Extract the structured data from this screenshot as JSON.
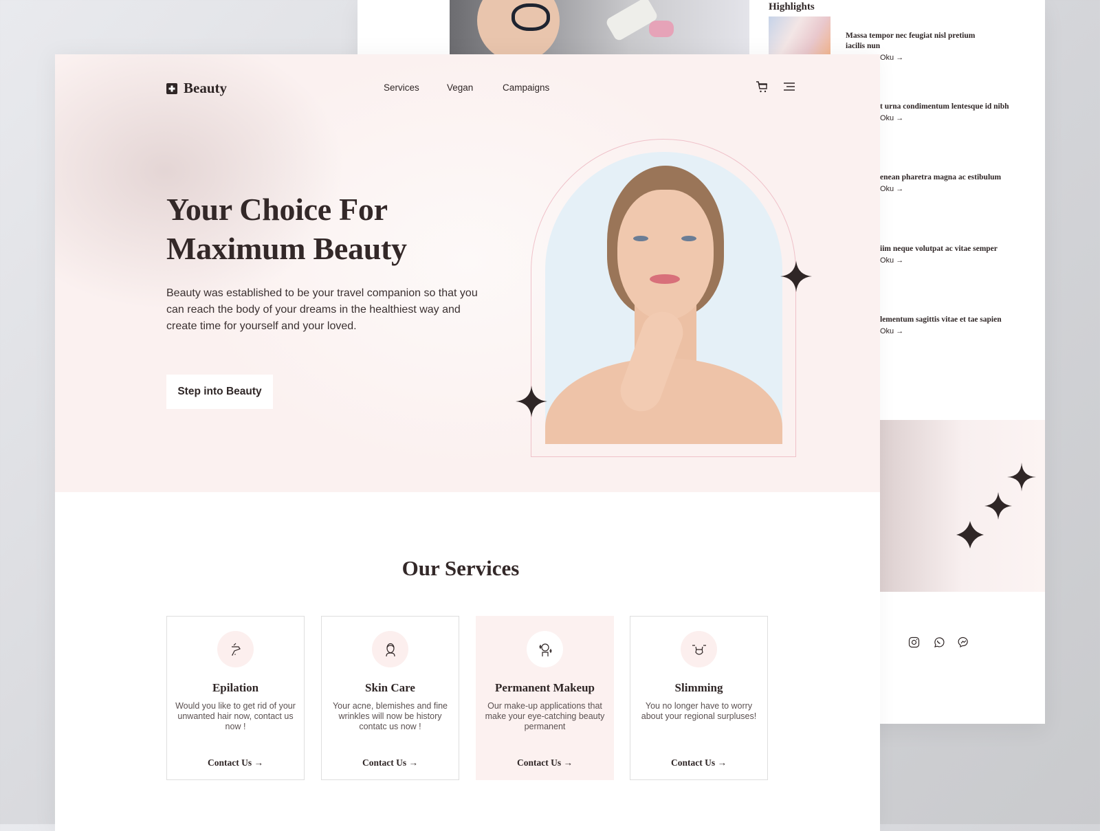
{
  "back_page": {
    "highlights_title": "Highlights",
    "highlights": [
      {
        "title": "Massa tempor nec feugiat nisl pretium iacilis nun",
        "link": "Oku"
      },
      {
        "title": "t urna condimentum lentesque id nibh",
        "link": "Oku"
      },
      {
        "title": "enean pharetra magna ac estibulum",
        "link": "Oku"
      },
      {
        "title": "iim neque volutpat ac vitae semper",
        "link": "Oku"
      },
      {
        "title": "lementum sagittis vitae et tae sapien",
        "link": "Oku"
      }
    ],
    "socials": [
      "instagram-icon",
      "whatsapp-icon",
      "messenger-icon"
    ]
  },
  "header": {
    "brand": "Beauty",
    "nav": [
      "Services",
      "Vegan",
      "Campaigns"
    ],
    "icons": [
      "cart-icon",
      "menu-icon"
    ]
  },
  "hero": {
    "title_line1": "Your Choice For",
    "title_line2": "Maximum Beauty",
    "description": "Beauty was established to be your travel companion so that you can reach the body of your dreams in the healthiest way and create time for yourself and your loved.",
    "cta": "Step into Beauty"
  },
  "services": {
    "title": "Our Services",
    "cards": [
      {
        "title": "Epilation",
        "desc": "Would you like to get rid of your unwanted hair now, contact us now !",
        "link": "Contact Us",
        "icon": "epilation-device-icon"
      },
      {
        "title": "Skin Care",
        "desc": "Your acne, blemishes and fine wrinkles will now be history contatc us now !",
        "link": "Contact Us",
        "icon": "woman-face-icon"
      },
      {
        "title": "Permanent Makeup",
        "desc": "Our make-up applications that make your eye-catching beauty permanent",
        "link": "Contact Us",
        "icon": "makeup-face-icon"
      },
      {
        "title": "Slimming",
        "desc": "You no longer have to worry about your regional surpluses!",
        "link": "Contact Us",
        "icon": "waist-icon"
      }
    ]
  },
  "colors": {
    "text": "#2f2626",
    "hero_bg": "#fbf1f0",
    "arch_border": "#efc1c9",
    "photo_bg": "#e5f0f7",
    "active_card": "#fcf1f0"
  }
}
